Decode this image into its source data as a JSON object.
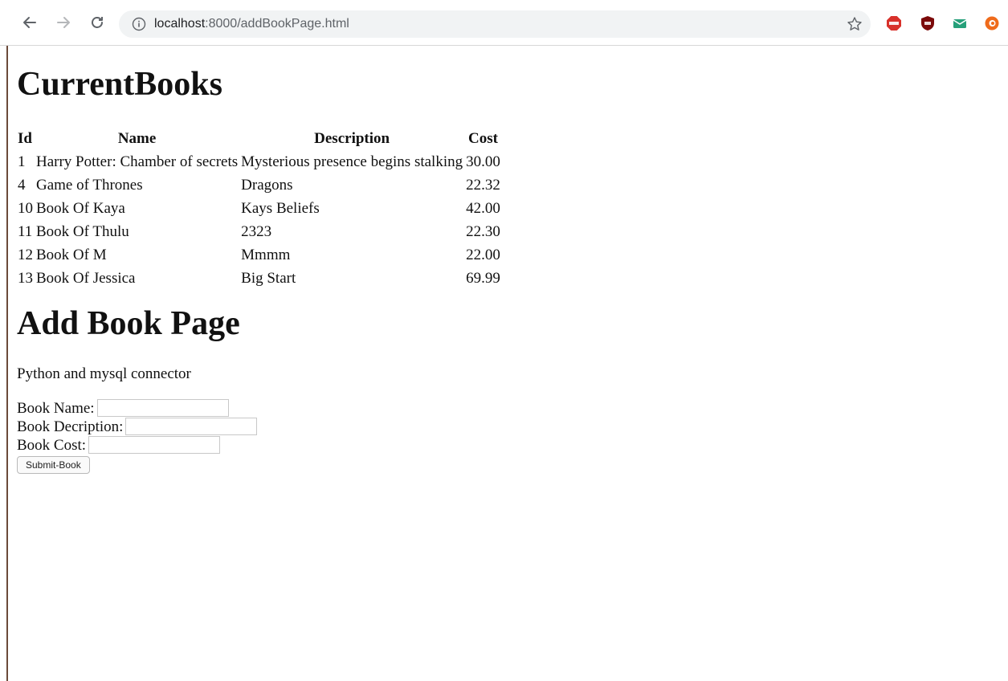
{
  "browser": {
    "url_host": "localhost",
    "url_path": ":8000/addBookPage.html",
    "extensions": [
      "abp-icon",
      "ublock-icon",
      "mail-icon",
      "orange-ext-icon"
    ]
  },
  "page": {
    "current_heading": "CurrentBooks",
    "table": {
      "headers": [
        "Id",
        "Name",
        "Description",
        "Cost"
      ],
      "rows": [
        {
          "id": "1",
          "name": "Harry Potter: Chamber of secrets",
          "description": "Mysterious presence begins stalking",
          "cost": "30.00"
        },
        {
          "id": "4",
          "name": "Game of Thrones",
          "description": "Dragons",
          "cost": "22.32"
        },
        {
          "id": "10",
          "name": "Book Of Kaya",
          "description": "Kays Beliefs",
          "cost": "42.00"
        },
        {
          "id": "11",
          "name": "Book Of Thulu",
          "description": "2323",
          "cost": "22.30"
        },
        {
          "id": "12",
          "name": "Book Of M",
          "description": "Mmmm",
          "cost": "22.00"
        },
        {
          "id": "13",
          "name": "Book Of Jessica",
          "description": "Big Start",
          "cost": "69.99"
        }
      ]
    },
    "add_heading": "Add Book Page",
    "subtitle": "Python and mysql connector",
    "form": {
      "name_label": "Book Name:",
      "name_value": "",
      "description_label": "Book Decription:",
      "description_value": "",
      "cost_label": "Book Cost:",
      "cost_value": "",
      "submit_label": "Submit-Book"
    }
  }
}
